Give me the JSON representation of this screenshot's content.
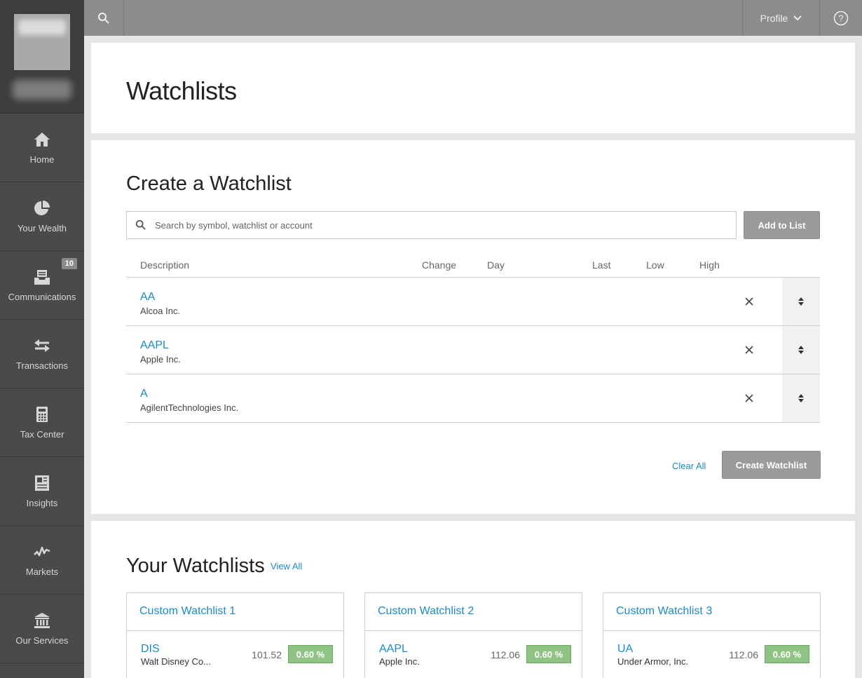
{
  "sidebar": {
    "items": [
      {
        "label": "Home",
        "icon": "home-icon"
      },
      {
        "label": "Your Wealth",
        "icon": "pie-chart-icon"
      },
      {
        "label": "Communications",
        "icon": "inbox-icon",
        "badge": "10"
      },
      {
        "label": "Transactions",
        "icon": "transfer-arrows-icon"
      },
      {
        "label": "Tax Center",
        "icon": "calculator-icon"
      },
      {
        "label": "Insights",
        "icon": "article-icon"
      },
      {
        "label": "Markets",
        "icon": "market-trend-icon"
      },
      {
        "label": "Our Services",
        "icon": "bank-icon"
      }
    ]
  },
  "topbar": {
    "profile_label": "Profile"
  },
  "page": {
    "title": "Watchlists"
  },
  "create": {
    "title": "Create a Watchlist",
    "search_placeholder": "Search by symbol, watchlist or account",
    "add_button": "Add to List",
    "columns": [
      "Description",
      "Change",
      "Day",
      "Last",
      "Low",
      "High"
    ],
    "rows": [
      {
        "symbol": "AA",
        "name": "Alcoa Inc."
      },
      {
        "symbol": "AAPL",
        "name": "Apple Inc."
      },
      {
        "symbol": "A",
        "name": "AgilentTechnologies Inc."
      }
    ],
    "clear_all": "Clear All",
    "create_button": "Create Watchlist"
  },
  "your_watchlists": {
    "title": "Your Watchlists",
    "view_all": "View All",
    "lists": [
      {
        "name": "Custom Watchlist 1",
        "symbol": "DIS",
        "company": "Walt Disney Co...",
        "price": "101.52",
        "change": "0.60 %"
      },
      {
        "name": "Custom Watchlist 2",
        "symbol": "AAPL",
        "company": "Apple Inc.",
        "price": "112.06",
        "change": "0.60 %"
      },
      {
        "name": "Custom Watchlist 3",
        "symbol": "UA",
        "company": "Under Armor, Inc.",
        "price": "112.06",
        "change": "0.60 %"
      }
    ]
  },
  "colors": {
    "sidebar": "#4a4a4a",
    "topbar": "#8c8c8c",
    "link": "#1a8ac9",
    "positive_change": "#8fc383"
  }
}
